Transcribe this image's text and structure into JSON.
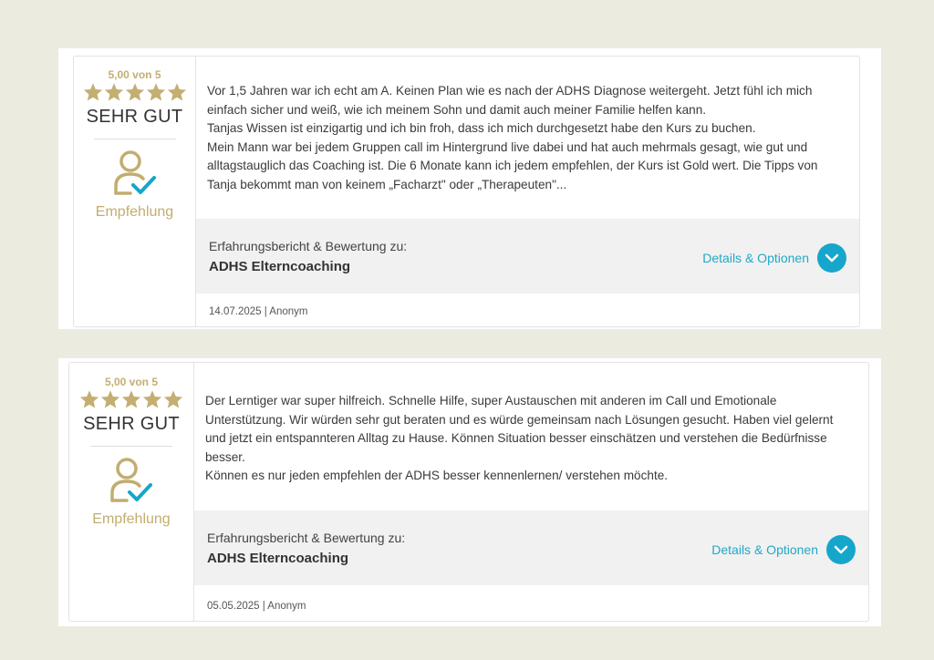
{
  "colors": {
    "gold": "#c4ae72",
    "accent": "#16a6cb",
    "background": "#ecebdf"
  },
  "reviews": [
    {
      "score": "5,00 von 5",
      "rating": 5,
      "verdict": "SEHR GUT",
      "recommendation_icon": "user-check-icon",
      "recommendation": "Empfehlung",
      "text": "Vor 1,5 Jahren war ich echt am A. Keinen Plan wie es nach der ADHS Diagnose weitergeht. Jetzt fühl ich mich\neinfach sicher und weiß, wie ich meinem Sohn und damit auch meiner Familie helfen kann.\nTanjas Wissen ist einzigartig und ich bin froh, dass ich mich durchgesetzt habe den Kurs zu buchen.\nMein Mann war bei jedem Gruppen call im Hintergrund live dabei und hat auch mehrmals gesagt, wie gut und\nalltagstauglich das Coaching ist. Die 6 Monate kann ich jedem empfehlen, der Kurs ist Gold wert. Die Tipps von\nTanja bekommt man von keinem „Facharzt\" oder „Therapeuten\"...",
      "product_label": "Erfahrungsbericht & Bewertung zu:",
      "product_name": "ADHS Elterncoaching",
      "details_label": "Details & Optionen",
      "meta": "14.07.2025 | Anonym"
    },
    {
      "score": "5,00 von 5",
      "rating": 5,
      "verdict": "SEHR GUT",
      "recommendation_icon": "user-check-icon",
      "recommendation": "Empfehlung",
      "text": "Der Lerntiger war super hilfreich. Schnelle Hilfe, super Austauschen mit anderen im Call und Emotionale\nUnterstützung. Wir würden sehr gut beraten und es würde gemeinsam nach Lösungen gesucht. Haben viel gelernt\nund jetzt ein entspannteren Alltag zu Hause. Können Situation besser einschätzen und verstehen die Bedürfnisse\nbesser.\nKönnen es nur jeden empfehlen der ADHS besser kennenlernen/ verstehen möchte.",
      "product_label": "Erfahrungsbericht & Bewertung zu:",
      "product_name": "ADHS Elterncoaching",
      "details_label": "Details & Optionen",
      "meta": "05.05.2025 | Anonym"
    }
  ]
}
